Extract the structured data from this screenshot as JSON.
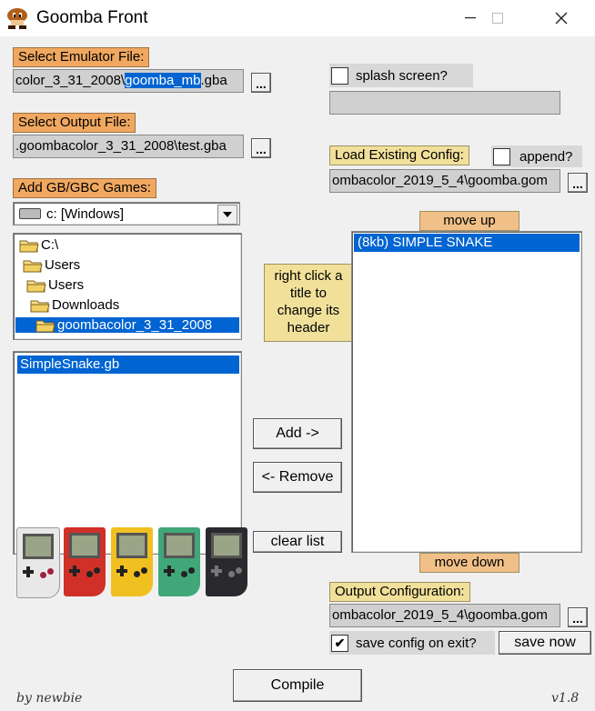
{
  "window": {
    "title": "Goomba Front",
    "minimize": "—",
    "maximize": "☐",
    "close": "✕"
  },
  "emulator": {
    "label": "Select Emulator File:",
    "path_before": "color_3_31_2008\\",
    "path_selected": "goomba_mb",
    "path_after": ".gba",
    "browse": "..."
  },
  "output_file": {
    "label": "Select Output File:",
    "path": ".goombacolor_3_31_2008\\test.gba",
    "browse": "..."
  },
  "games": {
    "label": "Add GB/GBC Games:",
    "drive": "c: [Windows]",
    "tree": [
      "C:\\",
      "Users",
      "Users",
      "Downloads",
      "goombacolor_3_31_2008"
    ],
    "files": [
      "SimpleSnake.gb"
    ]
  },
  "splash": {
    "label": "splash screen?",
    "checked": false
  },
  "load_config": {
    "label": "Load Existing Config:",
    "append_label": "append?",
    "append_checked": false,
    "path": "ombacolor_2019_5_4\\goomba.gom",
    "browse": "..."
  },
  "rom_list": {
    "move_up": "move up",
    "move_down": "move down",
    "items": [
      "(8kb)  SIMPLE SNAKE"
    ]
  },
  "hint": "right click a title to change its header",
  "buttons": {
    "add": "Add ->",
    "remove": "<- Remove",
    "clear": "clear list",
    "compile": "Compile",
    "save_now": "save now"
  },
  "output_config": {
    "label": "Output Configuration:",
    "path": "ombacolor_2019_5_4\\goomba.gom",
    "browse": "...",
    "save_on_exit_label": "save config on exit?",
    "save_on_exit_checked": true
  },
  "footer": {
    "author": "by newbie",
    "version": "v1.8"
  },
  "handhelds": [
    "white",
    "red",
    "yellow",
    "green",
    "black"
  ],
  "colors": {
    "orange_label": "#f0a860",
    "yellow_label": "#f0e09a",
    "selection": "#0064d2"
  }
}
